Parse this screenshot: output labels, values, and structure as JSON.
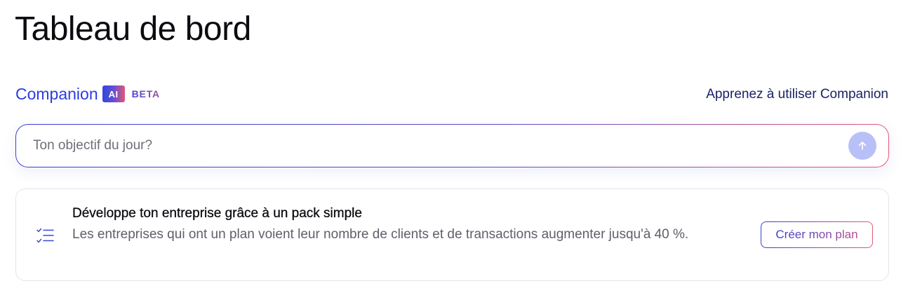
{
  "page": {
    "title": "Tableau de bord"
  },
  "companion": {
    "name": "Companion",
    "ai_badge": "AI",
    "beta_label": "BETA",
    "learn_link": "Apprenez à utiliser Companion"
  },
  "search": {
    "placeholder": "Ton objectif du jour?",
    "value": "",
    "send_icon": "arrow-up-icon"
  },
  "plan_card": {
    "icon": "checklist-icon",
    "title": "Développe ton entreprise grâce à un pack simple",
    "description": "Les entreprises qui ont un plan voient leur nombre de clients et de transactions augmenter jusqu'à 40 %.",
    "button_label": "Créer mon plan"
  },
  "colors": {
    "brand_blue": "#2d3de0",
    "gradient_start": "#3a3fd0",
    "gradient_end": "#e2587a",
    "send_button_bg": "#b8c0f7"
  }
}
